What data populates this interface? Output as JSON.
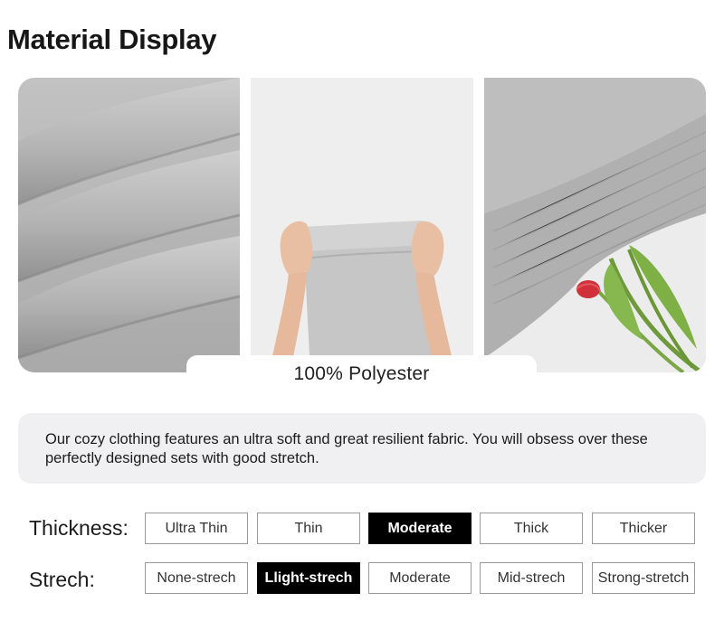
{
  "page": {
    "title": "Material Display"
  },
  "gallery": {
    "caption": "100% Polyester",
    "panels": [
      "fabric-folds-closeup",
      "hands-stretching-fabric",
      "sweatshirt-ribbed-hem-with-tulips"
    ]
  },
  "description": "Our cozy clothing features an ultra soft and great resilient fabric. You will obsess over these perfectly designed sets with good stretch.",
  "thickness": {
    "label": "Thickness:",
    "options": [
      "Ultra Thin",
      "Thin",
      "Moderate",
      "Thick",
      "Thicker"
    ],
    "selected": "Moderate"
  },
  "strech": {
    "label": "Strech:",
    "options": [
      "None-strech",
      "Llight-strech",
      "Moderate",
      "Mid-strech",
      "Strong-stretch"
    ],
    "selected": "Llight-strech"
  },
  "colors": {
    "fabric": "#b5b5b5",
    "selected": "#000000",
    "panel_bg": "#f0f0f2",
    "tulip": "#d0303a"
  }
}
